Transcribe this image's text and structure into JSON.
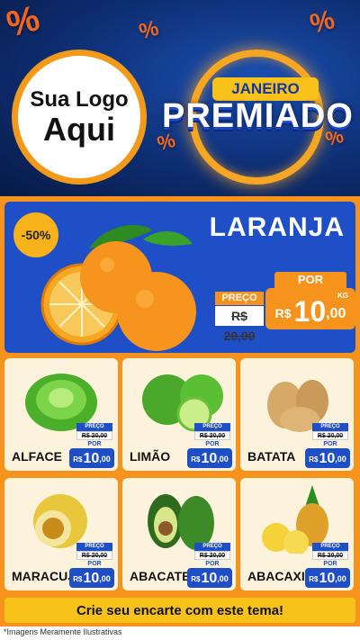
{
  "header": {
    "logo_line1": "Sua Logo",
    "logo_line2": "Aqui",
    "badge": "JANEIRO",
    "title": "PREMIADO",
    "percent_symbol": "%"
  },
  "featured": {
    "discount": "-50%",
    "name": "LARANJA",
    "preco_label": "PREÇO",
    "old_price": "R$ 20,00",
    "por_label": "POR",
    "currency": "R$",
    "price_int": "10",
    "price_cents": ",00",
    "unit": "KG"
  },
  "products": [
    {
      "name": "ALFACE",
      "preco_label": "PREÇO",
      "old_price": "R$ 20,00",
      "por_label": "POR",
      "currency": "R$",
      "price_int": "10",
      "price_cents": ",00"
    },
    {
      "name": "LIMÃO",
      "preco_label": "PREÇO",
      "old_price": "R$ 20,00",
      "por_label": "POR",
      "currency": "R$",
      "price_int": "10",
      "price_cents": ",00"
    },
    {
      "name": "BATATA",
      "preco_label": "PREÇO",
      "old_price": "R$ 20,00",
      "por_label": "POR",
      "currency": "R$",
      "price_int": "10",
      "price_cents": ",00"
    },
    {
      "name": "MARACUJÁ",
      "preco_label": "PREÇO",
      "old_price": "R$ 20,00",
      "por_label": "POR",
      "currency": "R$",
      "price_int": "10",
      "price_cents": ",00"
    },
    {
      "name": "ABACATE",
      "preco_label": "PREÇO",
      "old_price": "R$ 20,00",
      "por_label": "POR",
      "currency": "R$",
      "price_int": "10",
      "price_cents": ",00"
    },
    {
      "name": "ABACAXI",
      "preco_label": "PREÇO",
      "old_price": "R$ 20,00",
      "por_label": "POR",
      "currency": "R$",
      "price_int": "10",
      "price_cents": ",00"
    }
  ],
  "cta": "Crie seu encarte com este tema!",
  "footnote": "*Imagens Meramente Ilustrativas",
  "colors": {
    "blue": "#1f4fc7",
    "orange": "#f6931d",
    "yellow": "#f9c21b",
    "cream": "#fdf3dc"
  }
}
